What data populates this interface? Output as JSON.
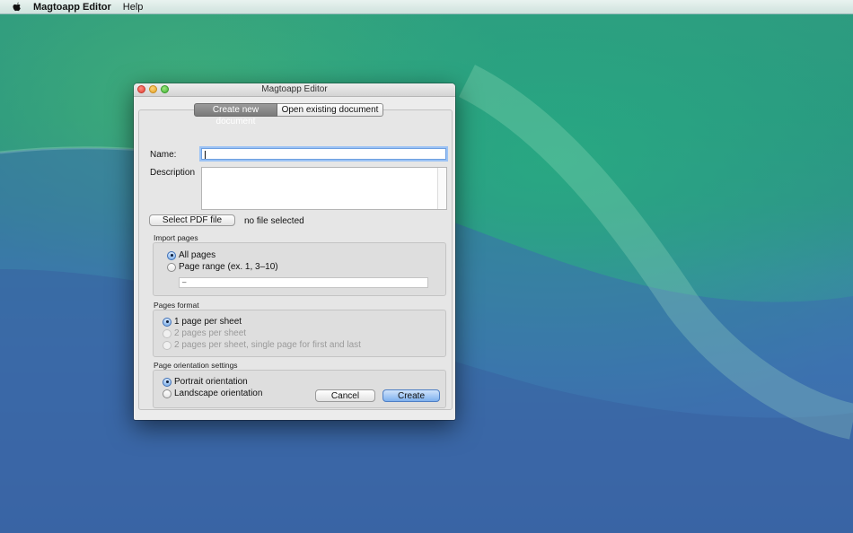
{
  "menubar": {
    "apple_icon": "apple-logo-icon",
    "app_name": "Magtoapp Editor",
    "items": [
      {
        "label": "Help"
      }
    ]
  },
  "window": {
    "title": "Magtoapp Editor",
    "tabs": [
      {
        "label": "Create new document",
        "active": true
      },
      {
        "label": "Open existing document",
        "active": false
      }
    ],
    "form": {
      "name_label": "Name:",
      "name_value": "",
      "description_label": "Description",
      "description_value": "",
      "select_pdf_label": "Select PDF file",
      "file_status": "no file selected"
    },
    "import_pages": {
      "title": "Import pages",
      "options": [
        {
          "label": "All pages",
          "selected": true,
          "enabled": true
        },
        {
          "label": "Page range (ex. 1, 3–10)",
          "selected": false,
          "enabled": true
        }
      ],
      "range_value": "–"
    },
    "pages_format": {
      "title": "Pages format",
      "options": [
        {
          "label": "1 page per sheet",
          "selected": true,
          "enabled": true
        },
        {
          "label": "2 pages per sheet",
          "selected": false,
          "enabled": false
        },
        {
          "label": "2 pages per sheet, single page for first and last",
          "selected": false,
          "enabled": false
        }
      ]
    },
    "orientation": {
      "title": "Page orientation settings",
      "options": [
        {
          "label": "Portrait orientation",
          "selected": true,
          "enabled": true
        },
        {
          "label": "Landscape orientation",
          "selected": false,
          "enabled": true
        }
      ]
    },
    "buttons": {
      "cancel": "Cancel",
      "create": "Create"
    }
  },
  "colors": {
    "accent": "#7fb1ee",
    "desktop_top": "#2f9a7f",
    "desktop_bottom": "#3a64a3"
  }
}
